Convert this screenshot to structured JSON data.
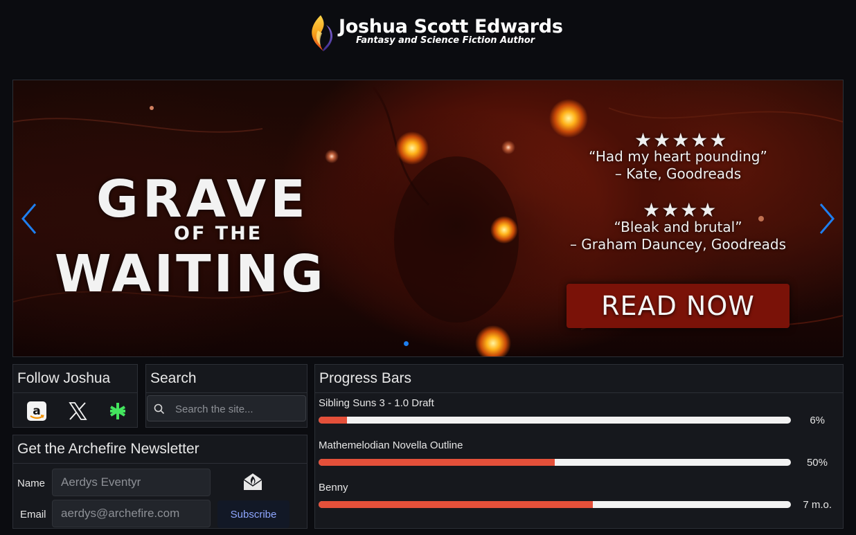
{
  "header": {
    "title": "Joshua Scott Edwards",
    "tagline": "Fantasy and Science Fiction Author",
    "logo_icon": "flame-logo-icon"
  },
  "hero": {
    "title_line1": "GRAVE",
    "title_line2": "OF THE",
    "title_line3": "WAITING",
    "review1": {
      "stars": "★★★★★",
      "quote": "“Had my heart pounding”",
      "attribution": "– Kate, Goodreads"
    },
    "review2": {
      "stars": "★★★★",
      "quote": "“Bleak and brutal”",
      "attribution": "– Graham Dauncey, Goodreads"
    },
    "cta_label": "READ NOW",
    "accent_color": "#1e7ff0"
  },
  "follow": {
    "title": "Follow Joshua",
    "icons": [
      "amazon-icon",
      "x-twitter-icon",
      "linktree-icon"
    ]
  },
  "search": {
    "title": "Search",
    "placeholder": "Search the site..."
  },
  "newsletter": {
    "title": "Get the Archefire Newsletter",
    "name_label": "Name",
    "name_placeholder": "Aerdys Eventyr",
    "email_label": "Email",
    "email_placeholder": "aerdys@archefire.com",
    "subscribe_label": "Subscribe"
  },
  "progress": {
    "title": "Progress Bars",
    "bar_color": "#e4503a",
    "items": [
      {
        "label": "Sibling Suns 3 - 1.0 Draft",
        "value_text": "6%",
        "fraction": 0.06
      },
      {
        "label": "Mathemelodian Novella Outline",
        "value_text": "50%",
        "fraction": 0.5
      },
      {
        "label": "Benny",
        "value_text": "7 m.o.",
        "fraction": 0.58
      }
    ]
  }
}
